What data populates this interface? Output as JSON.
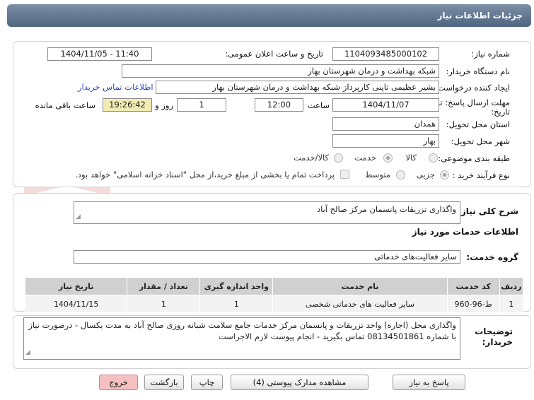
{
  "header": {
    "title": "جزئیات اطلاعات نیاز"
  },
  "form": {
    "need_number_label": "شماره نیاز:",
    "need_number": "1104093485000102",
    "announce_label": "تاریخ و ساعت اعلان عمومی:",
    "announce_value": "1404/11/05 - 11:40",
    "buyer_org_label": "نام دستگاه خریدار:",
    "buyer_org": "شبکه بهداشت و درمان شهرستان بهار",
    "creator_label": "ایجاد کننده درخواست:",
    "creator": "بشیر عظیمی تاپنی کارپرداز شبکه بهداشت و درمان شهرستان بهار",
    "contact_link": "اطلاعات تماس خریدار",
    "deadline_label_1": "مهلت ارسال پاسخ: تا",
    "deadline_label_2": "تاریخ:",
    "deadline_date": "1404/11/07",
    "time_label": "ساعت",
    "deadline_time": "12:00",
    "days_value": "1",
    "days_label": "روز و",
    "remaining_time": "19:26:42",
    "remaining_label": "ساعت باقی مانده",
    "province_label": "استان محل تحویل:",
    "province": "همدان",
    "city_label": "شهر محل تحویل:",
    "city": "بهار",
    "category_label": "طبقه بندی موضوعی:",
    "category_options": [
      "کالا",
      "خدمت",
      "کالا/خدمت"
    ],
    "process_label": "نوع فرآیند خرید :",
    "process_options": [
      "جزیی",
      "متوسط"
    ],
    "payment_note": "پرداخت تمام یا بخشی از مبلغ خرید،از محل \"اسناد خزانه اسلامی\" خواهد بود."
  },
  "description": {
    "label": "شرح کلی نیاز:",
    "value": "واگذاری تزریقات پانسمان مرکز صالح آباد"
  },
  "services": {
    "section_title": "اطلاعات خدمات مورد نیاز",
    "group_label": "گروه خدمت:",
    "group_value": "سایر فعالیت‌های خدماتی",
    "columns": [
      "ردیف",
      "کد خدمت",
      "نام خدمت",
      "واحد اندازه گیری",
      "تعداد / مقدار",
      "تاریخ نیاز"
    ],
    "rows": [
      [
        "1",
        "ط-96-960",
        "سایر فعالیت های خدماتی شخصی",
        "1",
        "1",
        "1404/11/15"
      ]
    ]
  },
  "buyer_notes": {
    "label_1": "توضیحات",
    "label_2": "خریدار:",
    "value": "واگذاری محل (اجاره) واحد تزریقات و پانسمان مرکز خدمات جامع سلامت شبانه روزی صالح آباد به مدت یکسال - درصورت نیاز با شماره 08134501861 تماس بگیرید - انجام پیوست لازم الاجراست"
  },
  "buttons": {
    "reply": "پاسخ به نیاز",
    "docs": "مشاهده مدارک پیوستی (4)",
    "print": "چاپ",
    "back": "بازگشت",
    "exit": "خروج"
  },
  "watermark": {
    "text": "AriaTender.neT"
  },
  "colors": {
    "accent": "#d32f2f",
    "header": "#5d738c",
    "exit_button": "#f6c0c0",
    "remaining_bg": "#f2ecb4"
  }
}
